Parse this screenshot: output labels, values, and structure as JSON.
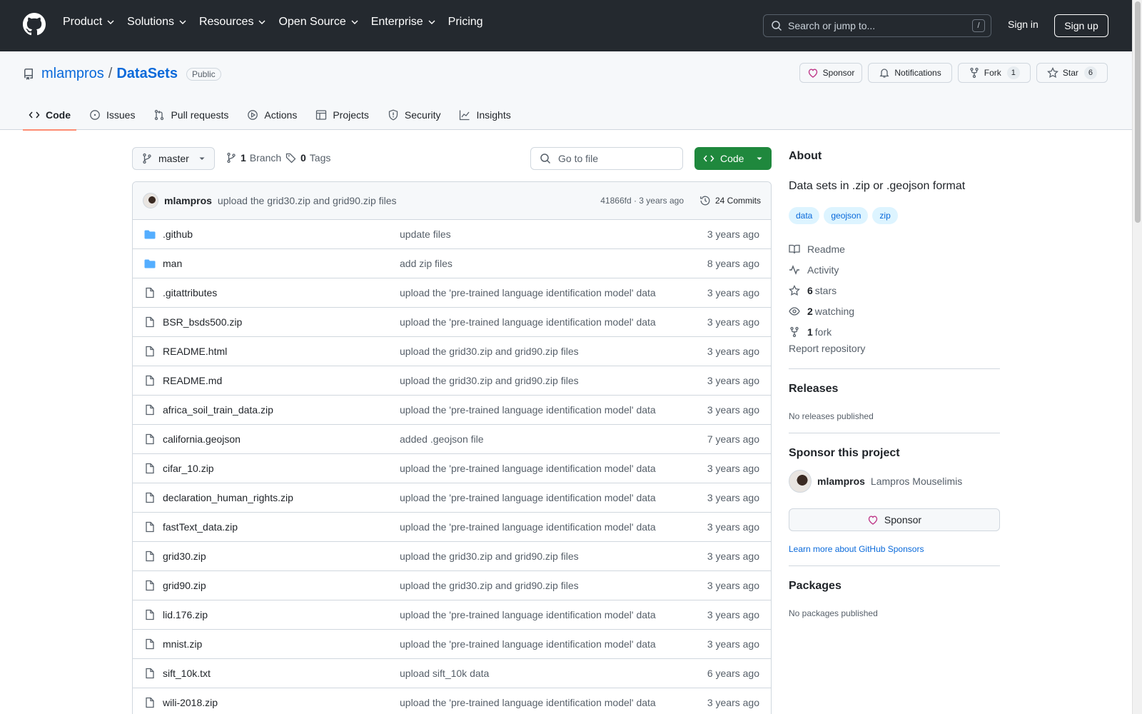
{
  "topbar": {
    "nav": [
      {
        "label": "Product",
        "has_caret": true
      },
      {
        "label": "Solutions",
        "has_caret": true
      },
      {
        "label": "Resources",
        "has_caret": true
      },
      {
        "label": "Open Source",
        "has_caret": true
      },
      {
        "label": "Enterprise",
        "has_caret": true
      },
      {
        "label": "Pricing",
        "has_caret": false
      }
    ],
    "search_placeholder": "Search or jump to...",
    "search_shortcut": "/",
    "signin": "Sign in",
    "signup": "Sign up"
  },
  "repo": {
    "owner": "mlampros",
    "separator": "/",
    "name": "DataSets",
    "visibility": "Public",
    "actions": {
      "sponsor": "Sponsor",
      "notifications": "Notifications",
      "fork": "Fork",
      "fork_count": "1",
      "star": "Star",
      "star_count": "6"
    },
    "tabs": [
      {
        "label": "Code",
        "icon": "code-icon",
        "active": true
      },
      {
        "label": "Issues",
        "icon": "issue-icon",
        "active": false
      },
      {
        "label": "Pull requests",
        "icon": "pull-request-icon",
        "active": false
      },
      {
        "label": "Actions",
        "icon": "play-icon",
        "active": false
      },
      {
        "label": "Projects",
        "icon": "table-icon",
        "active": false
      },
      {
        "label": "Security",
        "icon": "shield-icon",
        "active": false
      },
      {
        "label": "Insights",
        "icon": "graph-icon",
        "active": false
      }
    ]
  },
  "main": {
    "branch": "master",
    "branch_count": "1",
    "branch_label": "Branch",
    "tag_count": "0",
    "tag_label": "Tags",
    "goto_placeholder": "Go to file",
    "code_button": "Code",
    "latest_commit": {
      "author": "mlampros",
      "message": "upload the grid30.zip and grid90.zip files",
      "meta": "41866fd · 3 years ago",
      "commits": "24 Commits"
    },
    "files": [
      {
        "type": "dir",
        "name": ".github",
        "message": "update files",
        "age": "3 years ago"
      },
      {
        "type": "dir",
        "name": "man",
        "message": "add zip files",
        "age": "8 years ago"
      },
      {
        "type": "file",
        "name": ".gitattributes",
        "message": "upload the 'pre-trained language identification model' data",
        "age": "3 years ago"
      },
      {
        "type": "file",
        "name": "BSR_bsds500.zip",
        "message": "upload the 'pre-trained language identification model' data",
        "age": "3 years ago"
      },
      {
        "type": "file",
        "name": "README.html",
        "message": "upload the grid30.zip and grid90.zip files",
        "age": "3 years ago"
      },
      {
        "type": "file",
        "name": "README.md",
        "message": "upload the grid30.zip and grid90.zip files",
        "age": "3 years ago"
      },
      {
        "type": "file",
        "name": "africa_soil_train_data.zip",
        "message": "upload the 'pre-trained language identification model' data",
        "age": "3 years ago"
      },
      {
        "type": "file",
        "name": "california.geojson",
        "message": "added .geojson file",
        "age": "7 years ago"
      },
      {
        "type": "file",
        "name": "cifar_10.zip",
        "message": "upload the 'pre-trained language identification model' data",
        "age": "3 years ago"
      },
      {
        "type": "file",
        "name": "declaration_human_rights.zip",
        "message": "upload the 'pre-trained language identification model' data",
        "age": "3 years ago"
      },
      {
        "type": "file",
        "name": "fastText_data.zip",
        "message": "upload the 'pre-trained language identification model' data",
        "age": "3 years ago"
      },
      {
        "type": "file",
        "name": "grid30.zip",
        "message": "upload the grid30.zip and grid90.zip files",
        "age": "3 years ago"
      },
      {
        "type": "file",
        "name": "grid90.zip",
        "message": "upload the grid30.zip and grid90.zip files",
        "age": "3 years ago"
      },
      {
        "type": "file",
        "name": "lid.176.zip",
        "message": "upload the 'pre-trained language identification model' data",
        "age": "3 years ago"
      },
      {
        "type": "file",
        "name": "mnist.zip",
        "message": "upload the 'pre-trained language identification model' data",
        "age": "3 years ago"
      },
      {
        "type": "file",
        "name": "sift_10k.txt",
        "message": "upload sift_10k data",
        "age": "6 years ago"
      },
      {
        "type": "file",
        "name": "wili-2018.zip",
        "message": "upload the 'pre-trained language identification model' data",
        "age": "3 years ago"
      }
    ]
  },
  "sidebar": {
    "about_title": "About",
    "description": "Data sets in .zip or .geojson format",
    "topics": [
      "data",
      "geojson",
      "zip"
    ],
    "readme": "Readme",
    "activity": "Activity",
    "stars_count": "6",
    "stars_label": "stars",
    "watching_count": "2",
    "watching_label": "watching",
    "fork_count": "1",
    "fork_label": "fork",
    "report": "Report repository",
    "releases_title": "Releases",
    "releases_note": "No releases published",
    "sponsor_title": "Sponsor this project",
    "sponsor_user": "mlampros",
    "sponsor_fullname": "Lampros Mouselimis",
    "sponsor_button": "Sponsor",
    "learn_more": "Learn more about GitHub Sponsors",
    "packages_title": "Packages",
    "packages_note": "No packages published"
  },
  "colors": {
    "header_bg": "#24292f",
    "link": "#0969da",
    "green_button": "#1f883d",
    "active_tab_underline": "#fd8c73",
    "folder": "#54aeff",
    "sponsor_heart": "#bf3989"
  }
}
